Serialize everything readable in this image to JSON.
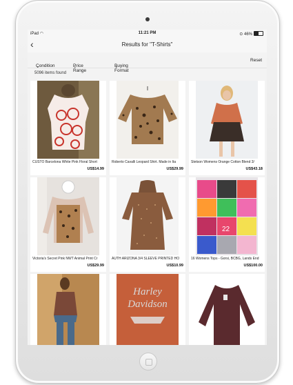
{
  "status": {
    "carrier": "iPad",
    "time": "11:21 PM",
    "battery": "46%",
    "battery_level": 0.46
  },
  "nav": {
    "title": "Results for \"T-Shirts\""
  },
  "filters": {
    "condition": "Condition",
    "price_range": "Price Range",
    "buying_format": "Buying Format",
    "reset": "Reset"
  },
  "results": {
    "count": "5096 items found"
  },
  "listings": [
    {
      "title": "CUSTO Barcelona White Pink Floral Short",
      "price": "US$14.99"
    },
    {
      "title": "Roberto Cavalli Leopard Shirt. Made in Ita",
      "price": "US$29.99"
    },
    {
      "title": "Stetson Womens Orange Cotton Blend 3/",
      "price": "US$43.18"
    },
    {
      "title": "Victoria's Secret Pink NWT Animal Print Cr",
      "price": "US$29.99"
    },
    {
      "title": "AUTH ARIZONA 3/4 SLEEVE PRINTED HO",
      "price": "US$10.99"
    },
    {
      "title": "16 Womens Tops - Gorsi, BCBG, Lands End",
      "price": "US$100.00"
    },
    {
      "title": "",
      "price": ""
    },
    {
      "title": "",
      "price": ""
    },
    {
      "title": "",
      "price": ""
    }
  ],
  "logo_text": {
    "line1": "Harley",
    "line2": "Davidson"
  },
  "colors": {
    "accent_red": "#c8342c",
    "harley_orange": "#c55f3a"
  }
}
